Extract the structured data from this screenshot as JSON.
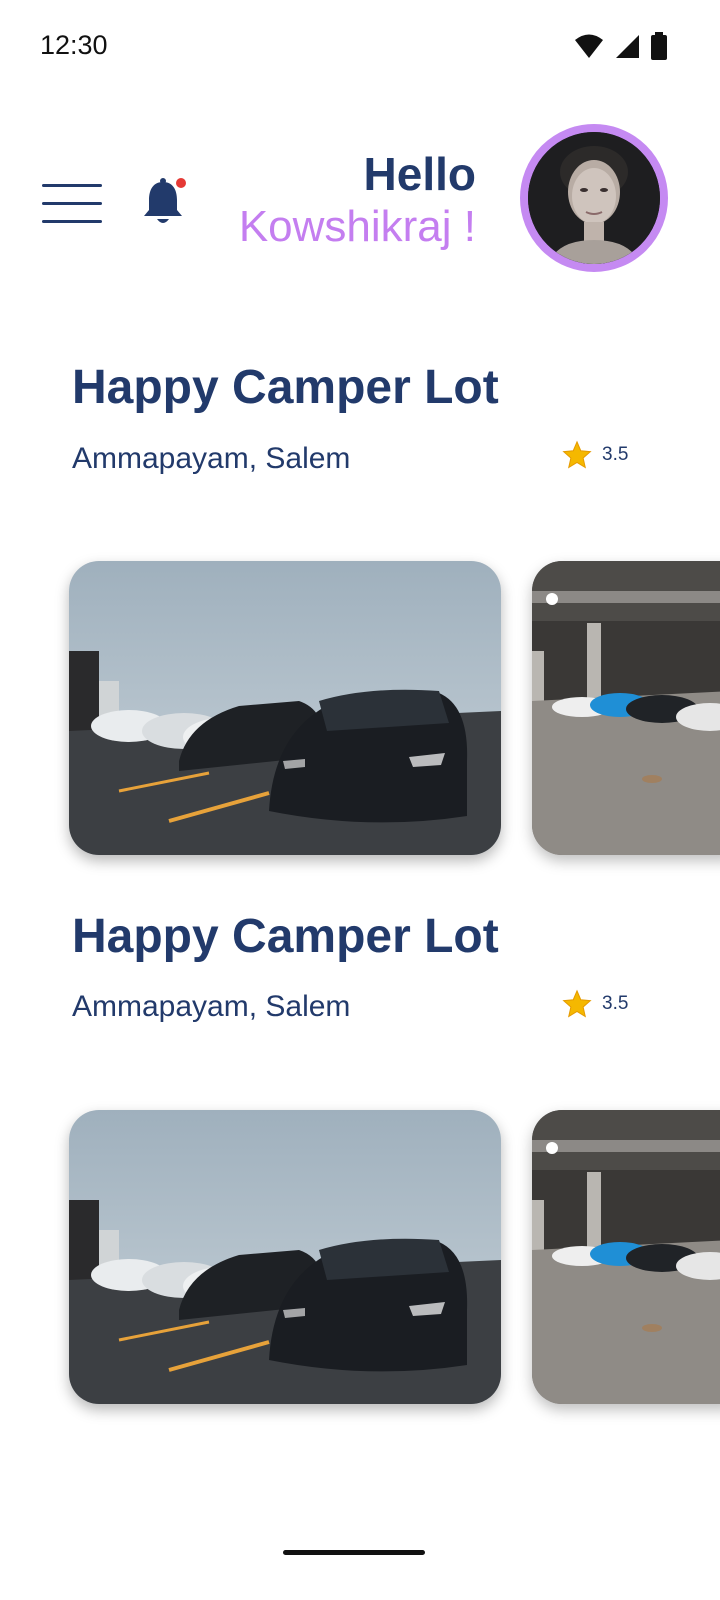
{
  "status_bar": {
    "time": "12:30",
    "icons": [
      "wifi-icon",
      "signal-icon",
      "battery-icon"
    ]
  },
  "header": {
    "greeting": "Hello",
    "user_name": "Kowshikraj !",
    "menu_icon": "hamburger-menu-icon",
    "notification_icon": "bell-icon",
    "notification_badge_color": "#e53935",
    "avatar_icon": "profile-avatar"
  },
  "colors": {
    "primary": "#223a6b",
    "accent": "#c47ef0",
    "avatar_ring": "#c58af2",
    "star": "#f5b800"
  },
  "lots": [
    {
      "title": "Happy Camper Lot",
      "location": "Ammapayam, Salem",
      "rating": "3.5",
      "images": [
        "outdoor-parking-lot-photo",
        "indoor-parking-garage-photo"
      ]
    },
    {
      "title": "Happy Camper Lot",
      "location": "Ammapayam, Salem",
      "rating": "3.5",
      "images": [
        "outdoor-parking-lot-photo",
        "indoor-parking-garage-photo"
      ]
    }
  ]
}
